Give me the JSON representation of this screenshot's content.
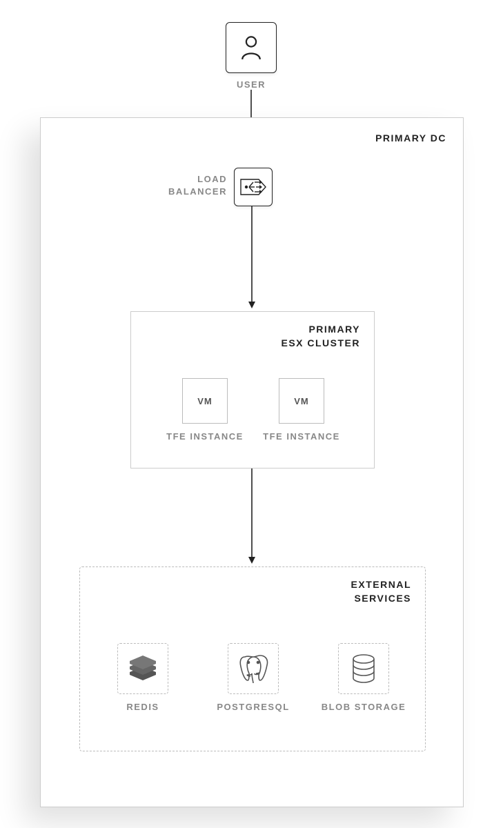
{
  "user": {
    "label": "USER"
  },
  "primary_dc": {
    "label": "PRIMARY DC"
  },
  "load_balancer": {
    "label": "LOAD\nBALANCER"
  },
  "esx_cluster": {
    "label": "PRIMARY\nESX CLUSTER",
    "vms": [
      {
        "box": "VM",
        "label": "TFE INSTANCE"
      },
      {
        "box": "VM",
        "label": "TFE INSTANCE"
      }
    ]
  },
  "external_services": {
    "label": "EXTERNAL\nSERVICES",
    "items": [
      {
        "name": "REDIS"
      },
      {
        "name": "POSTGRESQL"
      },
      {
        "name": "BLOB STORAGE"
      }
    ]
  }
}
